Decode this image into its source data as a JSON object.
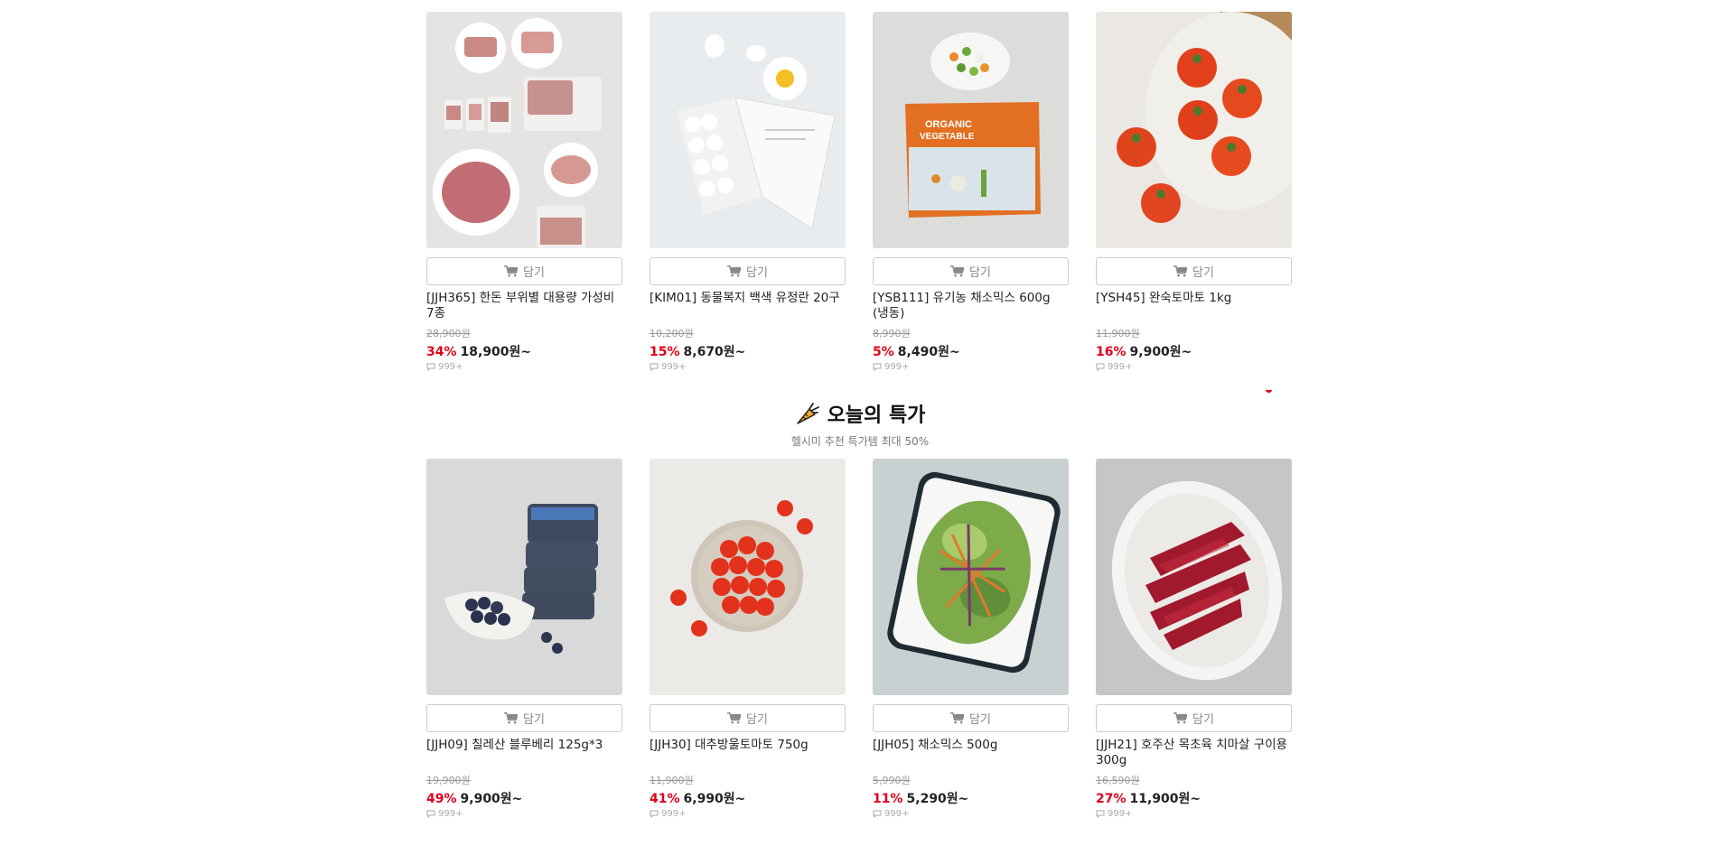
{
  "colors": {
    "discount": "#e0001b",
    "border": "#cccccc",
    "muted": "#999999"
  },
  "cart_label": "담기",
  "section": {
    "title": "오늘의 특가",
    "subtitle": "헬시미 추천 특가템 최대 50%",
    "icon": "carrot-icon"
  },
  "top_products": [
    {
      "name": "[JJH365] 한돈 부위별 대용량 가성비 7종",
      "original": "28,900원",
      "discount": "34%",
      "price": "18,900원~",
      "reviews": "999+",
      "image": "pork-cuts"
    },
    {
      "name": "[KIM01] 동물복지 백색 유정란 20구",
      "original": "10,200원",
      "discount": "15%",
      "price": "8,670원~",
      "reviews": "999+",
      "image": "eggs"
    },
    {
      "name": "[YSB111] 유기농 채소믹스 600g (냉동)",
      "original": "8,990원",
      "discount": "5%",
      "price": "8,490원~",
      "reviews": "999+",
      "image": "vegetable-mix"
    },
    {
      "name": "[YSH45] 완숙토마토 1kg",
      "original": "11,900원",
      "discount": "16%",
      "price": "9,900원~",
      "reviews": "999+",
      "image": "tomatoes"
    }
  ],
  "deal_products": [
    {
      "name": "[JJH09] 칠레산 블루베리 125g*3",
      "original": "19,900원",
      "discount": "49%",
      "price": "9,900원~",
      "reviews": "999+",
      "image": "blueberries"
    },
    {
      "name": "[JJH30] 대추방울토마토 750g",
      "original": "11,900원",
      "discount": "41%",
      "price": "6,990원~",
      "reviews": "999+",
      "image": "cherry-tomatoes"
    },
    {
      "name": "[JJH05] 채소믹스 500g",
      "original": "5,990원",
      "discount": "11%",
      "price": "5,290원~",
      "reviews": "999+",
      "image": "salad-mix"
    },
    {
      "name": "[JJH21] 호주산 목초육 치마살 구이용 300g",
      "original": "16,590원",
      "discount": "27%",
      "price": "11,900원~",
      "reviews": "999+",
      "image": "beef-skirt"
    }
  ]
}
